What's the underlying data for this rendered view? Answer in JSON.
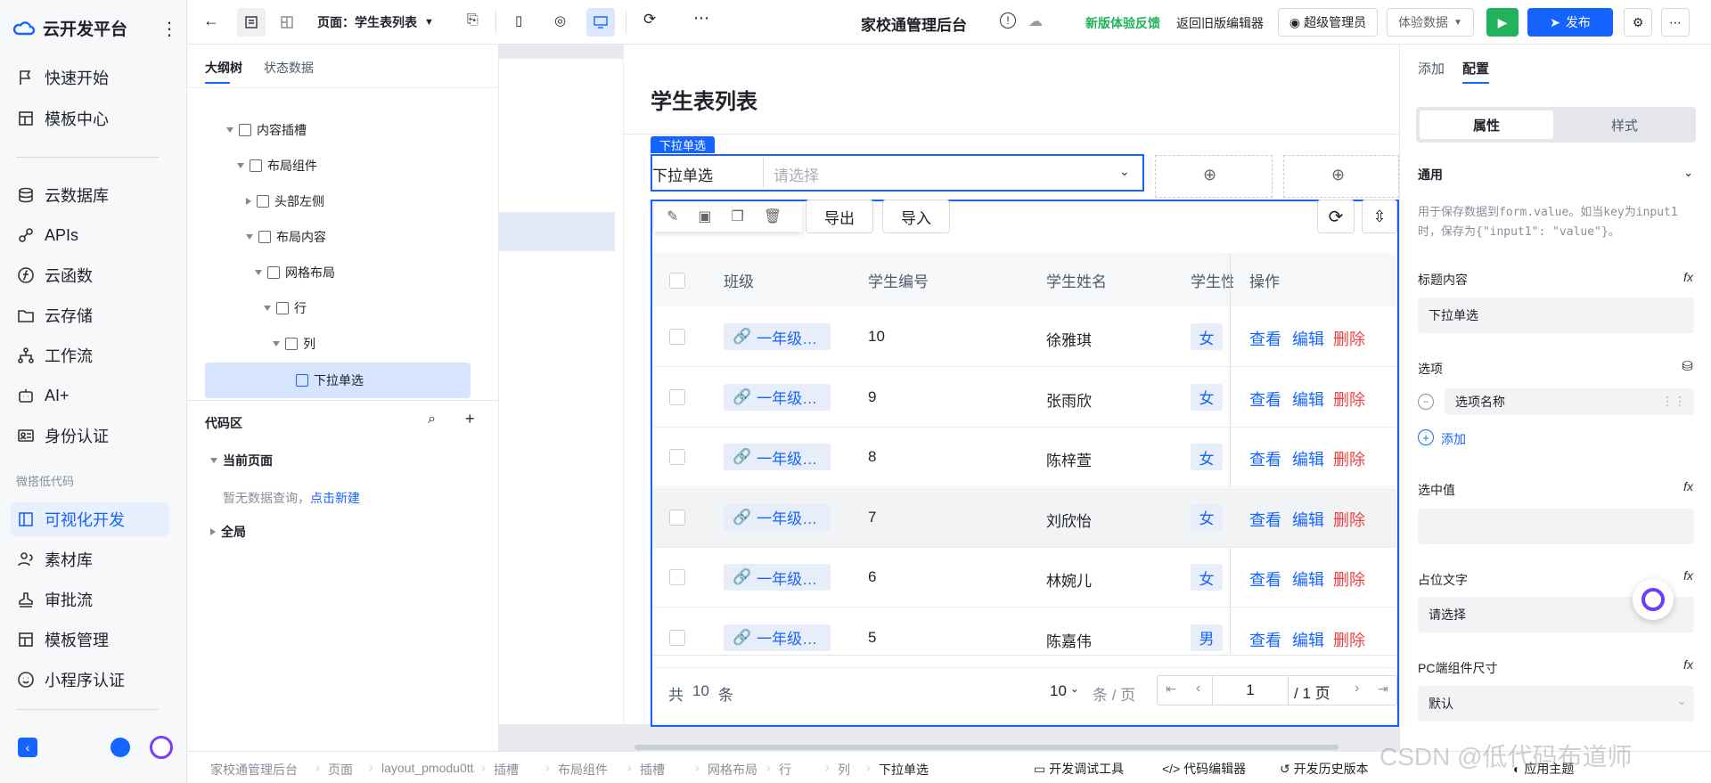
{
  "app": {
    "name": "云开发平台",
    "page_title": "家校通管理后台"
  },
  "nav": {
    "items": [
      {
        "label": "快速开始",
        "icon": "flag-icon"
      },
      {
        "label": "模板中心",
        "icon": "template-icon"
      },
      {
        "label": "云数据库",
        "icon": "database-icon"
      },
      {
        "label": "APIs",
        "icon": "link-icon"
      },
      {
        "label": "云函数",
        "icon": "function-icon"
      },
      {
        "label": "云存储",
        "icon": "folder-icon"
      },
      {
        "label": "工作流",
        "icon": "workflow-icon"
      },
      {
        "label": "AI+",
        "icon": "robot-icon"
      },
      {
        "label": "身份认证",
        "icon": "id-card-icon"
      },
      {
        "label": "可视化开发",
        "icon": "layout-icon"
      },
      {
        "label": "素材库",
        "icon": "users-icon"
      },
      {
        "label": "审批流",
        "icon": "stamp-icon"
      },
      {
        "label": "模板管理",
        "icon": "template-icon"
      },
      {
        "label": "小程序认证",
        "icon": "smile-icon"
      }
    ],
    "section_label": "微搭低代码"
  },
  "topbar": {
    "page_selector": "页面：学生表列表",
    "feedback": "新版体验反馈",
    "back_old": "返回旧版编辑器",
    "admin": "超级管理员",
    "data_select": "体验数据",
    "publish": "发布"
  },
  "outline": {
    "tabs": [
      "大纲树",
      "状态数据"
    ],
    "tree": [
      {
        "label": "内容插槽"
      },
      {
        "label": "布局组件"
      },
      {
        "label": "头部左侧"
      },
      {
        "label": "布局内容"
      },
      {
        "label": "网格布局"
      },
      {
        "label": "行"
      },
      {
        "label": "列"
      },
      {
        "label": "下拉单选"
      }
    ],
    "code_area": "代码区",
    "current_page": "当前页面",
    "empty_hint": "暂无数据查询，",
    "create_link": "点击新建",
    "global": "全局"
  },
  "canvas": {
    "title": "学生表列表",
    "select_badge": "下拉单选",
    "select_label": "下拉单选",
    "select_placeholder": "请选择",
    "export": "导出",
    "import": "导入",
    "columns": [
      "班级",
      "学生编号",
      "学生姓名",
      "学生性",
      "操作"
    ],
    "rows": [
      {
        "class": "一年级…",
        "id": "10",
        "name": "徐雅琪",
        "sex": "女"
      },
      {
        "class": "一年级…",
        "id": "9",
        "name": "张雨欣",
        "sex": "女"
      },
      {
        "class": "一年级…",
        "id": "8",
        "name": "陈梓萱",
        "sex": "女"
      },
      {
        "class": "一年级…",
        "id": "7",
        "name": "刘欣怡",
        "sex": "女"
      },
      {
        "class": "一年级…",
        "id": "6",
        "name": "林婉儿",
        "sex": "女"
      },
      {
        "class": "一年级…",
        "id": "5",
        "name": "陈嘉伟",
        "sex": "男"
      }
    ],
    "actions": {
      "view": "查看",
      "edit": "编辑",
      "delete": "删除"
    },
    "pager": {
      "total_prefix": "共",
      "total": "10",
      "total_suffix": "条",
      "page_size": "10",
      "per_page": "条 / 页",
      "page": "1",
      "pages": "/ 1 页"
    }
  },
  "rpanel": {
    "tabs": [
      "添加",
      "配置"
    ],
    "seg": [
      "属性",
      "样式"
    ],
    "general": "通用",
    "hint": "用于保存数据到form.value。如当key为input1时，保存为{\"input1\": \"value\"}。",
    "title_label": "标题内容",
    "title_value": "下拉单选",
    "options_label": "选项",
    "option_name": "选项名称",
    "add": "添加",
    "selected_label": "选中值",
    "placeholder_label": "占位文字",
    "placeholder_value": "请选择",
    "size_label": "PC端组件尺寸",
    "size_value": "默认",
    "fx": "fx"
  },
  "bottombar": {
    "breadcrumb": [
      "家校通管理后台",
      "页面",
      "layout_pmodu0tt",
      "插槽",
      "布局组件",
      "插槽",
      "网格布局",
      "行",
      "列",
      "下拉单选"
    ],
    "debug": "开发调试工具",
    "code_editor": "代码编辑器",
    "history": "开发历史版本",
    "theme": "应用主题",
    "watermark": "CSDN @低代码布道师"
  },
  "colors": {
    "primary": "#1664ff",
    "danger": "#f53f3f",
    "success": "#21b35b"
  }
}
